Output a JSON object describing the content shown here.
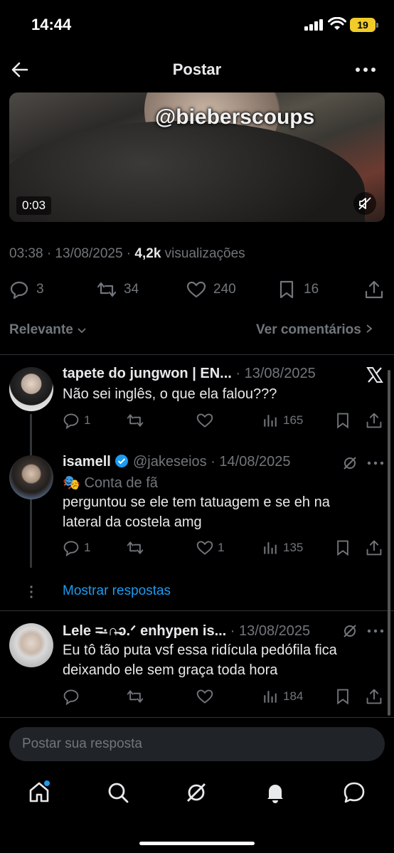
{
  "status_bar": {
    "time": "14:44",
    "battery": "19"
  },
  "header": {
    "title": "Postar"
  },
  "video": {
    "watermark": "@bieberscoups",
    "duration": "0:03"
  },
  "post_meta": {
    "time_date": "03:38 · 13/08/2025 · ",
    "views_count": "4,2k",
    "views_label": " visualizações"
  },
  "actions": {
    "replies": "3",
    "reposts": "34",
    "likes": "240",
    "bookmarks": "16"
  },
  "filter": {
    "sort": "Relevante",
    "view_comments": "Ver comentários"
  },
  "replies": [
    {
      "name": "tapete do jungwon | EN...",
      "handle": "",
      "date": "· 13/08/2025",
      "text": "Não sei inglês, o que ela falou???",
      "replies": "1",
      "reposts": "",
      "likes": "",
      "views": "165"
    },
    {
      "name": "isamell",
      "handle": "@jakeseios",
      "date": "· 14/08/2025",
      "fan_badge": "Conta de fã",
      "text": "perguntou se ele tem tatuagem e se eh na lateral da costela amg",
      "replies": "1",
      "reposts": "",
      "likes": "1",
      "views": "135"
    },
    {
      "name": "Lele =̶·∩̶ɔ.ᐟ enhypen is...",
      "handle": "",
      "date": "· 13/08/2025",
      "text": "Eu tô tão puta vsf essa ridícula pedófila fica deixando ele sem graça toda hora",
      "replies": "",
      "reposts": "",
      "likes": "",
      "views": "184"
    }
  ],
  "show_replies": "Mostrar respostas",
  "reply_input": {
    "placeholder": "Postar sua resposta"
  },
  "colors": {
    "accent": "#1d9bf0",
    "muted": "#71767b",
    "background": "#000000"
  }
}
